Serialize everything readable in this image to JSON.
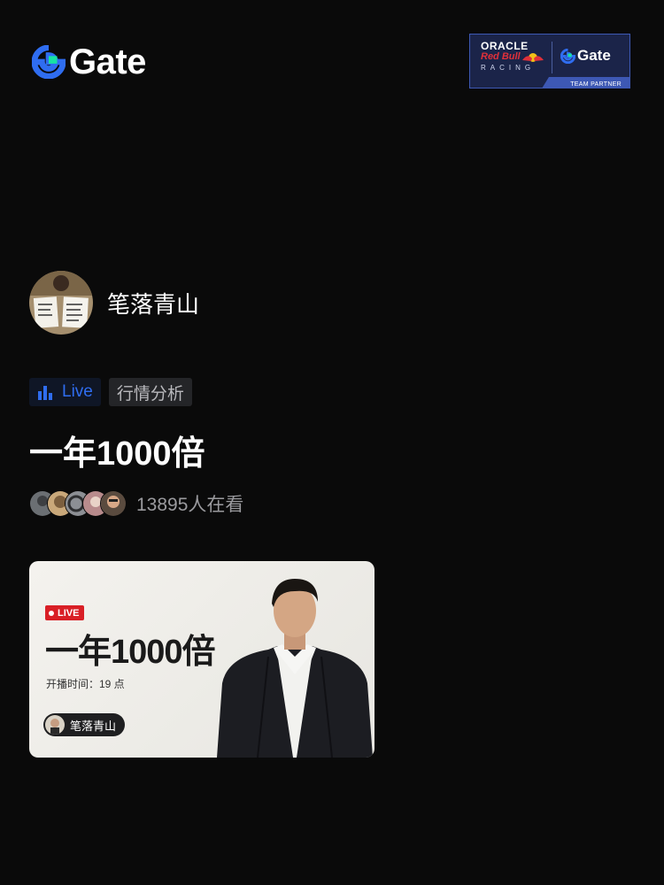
{
  "brand": {
    "name": "Gate",
    "logo_icon": "gate-logo-icon"
  },
  "partner": {
    "oracle": "ORACLE",
    "redbull": "Red Bull",
    "racing": "RACING",
    "gate": "Gate",
    "team_partner": "TEAM PARTNER"
  },
  "streamer": {
    "name": "笔落青山"
  },
  "tags": {
    "live": "Live",
    "category": "行情分析"
  },
  "stream": {
    "title": "一年1000倍",
    "viewers": "13895人在看"
  },
  "thumbnail": {
    "live_badge": "LIVE",
    "title": "一年1000倍",
    "start_time": "开播时间：19 点",
    "host": "笔落青山"
  },
  "colors": {
    "background": "#0a0a0a",
    "accent": "#2f6df0",
    "live_red": "#d91f26"
  }
}
